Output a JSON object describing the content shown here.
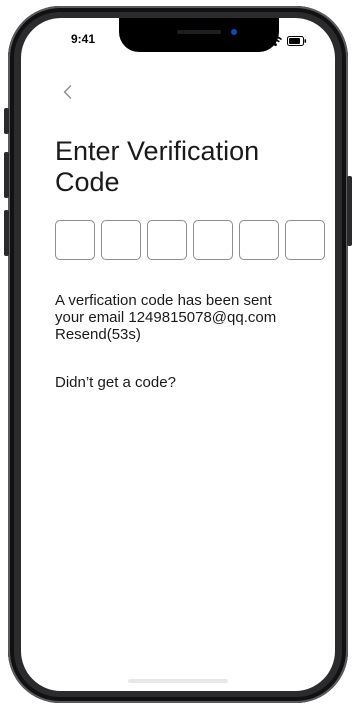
{
  "status_bar": {
    "time": "9:41",
    "icons": [
      "signal-icon",
      "wifi-icon",
      "battery-icon"
    ]
  },
  "navigation": {
    "back_icon": "chevron-left-icon"
  },
  "page": {
    "title_line1": "Enter Verification",
    "title_line2": "Code"
  },
  "code_input": {
    "box_count": 6,
    "values": [
      "",
      "",
      "",
      "",
      "",
      ""
    ]
  },
  "message": {
    "line1": "A verfication code has been sent",
    "line2": "your email 1249815078@qq.com",
    "resend_label": "Resend(53s)"
  },
  "help": {
    "no_code_label": "Didn’t get a code?"
  },
  "colors": {
    "text": "#1a1a1a",
    "box_border": "#8e8e8e",
    "frame": "#1c1c1e"
  }
}
